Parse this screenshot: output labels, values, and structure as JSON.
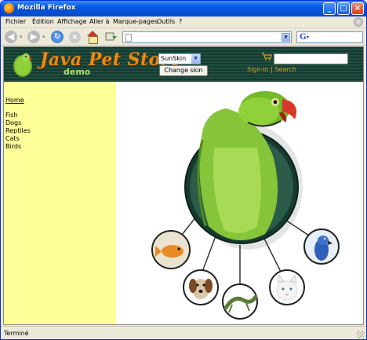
{
  "window": {
    "title": "Mozilla Firefox"
  },
  "menubar": {
    "items": [
      "Fichier",
      "Édition",
      "Affichage",
      "Aller à",
      "Marque-pages",
      "Outils",
      "?"
    ]
  },
  "toolbar": {
    "url_value": "",
    "search_engine": "Google"
  },
  "page": {
    "banner": {
      "logo_title": "Java Pet Store",
      "logo_subtitle": "demo",
      "skin_select_value": "SunSkin",
      "skin_button_label": "Change skin",
      "sign_in_label": "Sign-in",
      "separator": "|",
      "search_label": "Search"
    },
    "sidebar": {
      "home_link": "Home",
      "categories": [
        "Fish",
        "Dogs",
        "Reptiles",
        "Cats",
        "Birds"
      ]
    }
  },
  "status": {
    "text": "Terminé"
  },
  "colors": {
    "sidebar_bg": "#ffff99",
    "banner_bg": "#1f4f41",
    "logo_orange": "#e98b1a",
    "demo_green": "#aee36a",
    "titlebar_blue": "#0058e6"
  },
  "icons": [
    "firefox-icon",
    "back-arrow-icon",
    "forward-arrow-icon",
    "reload-icon",
    "stop-icon",
    "home-icon",
    "page-icon",
    "google-icon",
    "cart-icon",
    "parrot-logo-icon"
  ]
}
